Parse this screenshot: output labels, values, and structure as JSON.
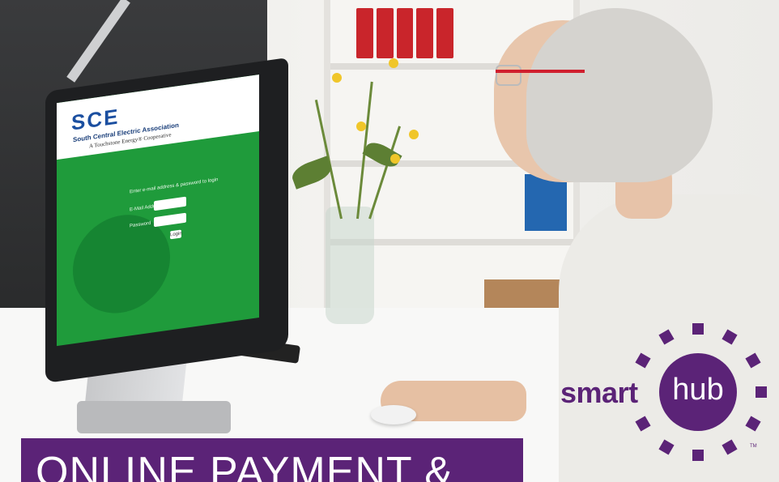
{
  "banner": {
    "text": "ONLINE PAYMENT &"
  },
  "brand": {
    "smart": "smart",
    "hub": "hub",
    "trademark": "TM"
  },
  "screen": {
    "logo": "SCE",
    "org_name": "South Central Electric Association",
    "tagline": "A Touchstone Energy® Cooperative",
    "login_prompt": "Enter e-mail address & password to login",
    "email_label": "E-Mail Address",
    "password_label": "Password",
    "login_button": "Login"
  },
  "colors": {
    "brand_purple": "#5b2377",
    "screen_green": "#1f9b3b",
    "sce_blue": "#1b4fa0"
  }
}
